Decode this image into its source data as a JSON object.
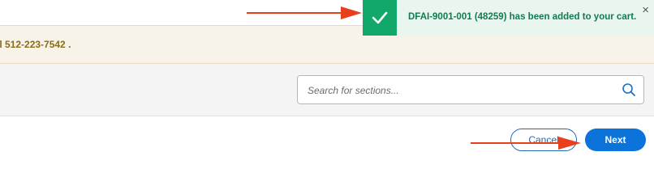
{
  "notice": {
    "text": "ll 512-223-7542 ."
  },
  "search": {
    "placeholder": "Search for sections..."
  },
  "toast": {
    "message": "DFAI-9001-001 (48259) has been added to your cart.",
    "close_label": "×",
    "status_color": "#11a86a",
    "icon": "check-icon"
  },
  "actions": {
    "cancel_label": "Cancel",
    "next_label": "Next"
  },
  "annotations": {
    "arrow_color": "#e8401d"
  },
  "colors": {
    "accent": "#0b73d9",
    "notice_text": "#8a6a1c",
    "success": "#11a86a"
  }
}
